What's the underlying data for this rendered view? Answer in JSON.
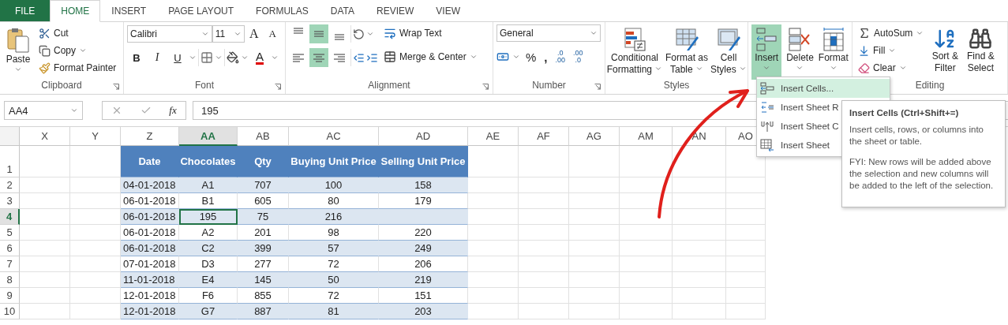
{
  "tabs": [
    {
      "label": "FILE",
      "kind": "file",
      "selected": false
    },
    {
      "label": "HOME",
      "kind": "tab",
      "selected": true
    },
    {
      "label": "INSERT",
      "kind": "tab",
      "selected": false
    },
    {
      "label": "PAGE LAYOUT",
      "kind": "tab",
      "selected": false
    },
    {
      "label": "FORMULAS",
      "kind": "tab",
      "selected": false
    },
    {
      "label": "DATA",
      "kind": "tab",
      "selected": false
    },
    {
      "label": "REVIEW",
      "kind": "tab",
      "selected": false
    },
    {
      "label": "VIEW",
      "kind": "tab",
      "selected": false
    }
  ],
  "clipboard": {
    "label": "Clipboard",
    "paste": "Paste",
    "cut": "Cut",
    "copy": "Copy",
    "format_painter": "Format Painter"
  },
  "font": {
    "label": "Font",
    "name": "Calibri",
    "size": "11",
    "grow": "A",
    "shrink": "A",
    "bold": "B",
    "italic": "I",
    "underline": "U",
    "font_color": "A"
  },
  "alignment": {
    "label": "Alignment",
    "vertical": [
      {
        "selected": false
      },
      {
        "selected": true
      },
      {
        "selected": false
      }
    ],
    "horizontal": [
      {
        "selected": false
      },
      {
        "selected": true
      },
      {
        "selected": false
      }
    ],
    "wrap_text": "Wrap Text",
    "merge_center": "Merge & Center"
  },
  "number": {
    "label": "Number",
    "format": "General",
    "percent": "%",
    "comma": ",",
    "decimals": [
      {
        "top": ".0",
        "bottom": ".00"
      },
      {
        "top": ".00",
        "bottom": ".0"
      }
    ]
  },
  "styles": {
    "label": "Styles",
    "buttons": [
      {
        "kind": "conditional",
        "lines": [
          "Conditional",
          "Formatting"
        ]
      },
      {
        "kind": "table",
        "lines": [
          "Format as",
          "Table"
        ]
      },
      {
        "kind": "cell",
        "lines": [
          "Cell",
          "Styles"
        ]
      }
    ]
  },
  "cells": {
    "buttons": [
      {
        "kind": "insert",
        "label": "Insert",
        "selected": true
      },
      {
        "kind": "delete",
        "label": "Delete",
        "selected": false
      },
      {
        "kind": "format",
        "label": "Format",
        "selected": false
      }
    ]
  },
  "editing": {
    "label": "Editing",
    "autosum": "AutoSum",
    "fill": "Fill",
    "clear": "Clear",
    "sort": [
      "Sort &",
      "Filter"
    ],
    "find": [
      "Find &",
      "Select"
    ]
  },
  "formula_bar": {
    "name_box": "AA4",
    "function_label": "fx",
    "value": "195"
  },
  "sheet": {
    "columns": [
      {
        "label": "X",
        "selected": false
      },
      {
        "label": "Y",
        "selected": false
      },
      {
        "label": "Z",
        "selected": false
      },
      {
        "label": "AA",
        "selected": true
      },
      {
        "label": "AB",
        "selected": false
      },
      {
        "label": "AC",
        "selected": false
      },
      {
        "label": "AD",
        "selected": false
      },
      {
        "label": "AE",
        "selected": false
      },
      {
        "label": "AF",
        "selected": false
      },
      {
        "label": "AG",
        "selected": false
      },
      {
        "label": "AM",
        "selected": false
      },
      {
        "label": "AN",
        "selected": false
      },
      {
        "label": "AO",
        "selected": false
      }
    ],
    "rows": [
      {
        "label": "1",
        "kind": "header",
        "selected": false,
        "cells": [
          "",
          "",
          "Date",
          "Chocolates",
          "Qty",
          "Buying Unit Price",
          "Selling Unit Price"
        ]
      },
      {
        "label": "2",
        "kind": "data",
        "selected": false,
        "cells": [
          "",
          "",
          "04-01-2018",
          "A1",
          "707",
          "100",
          "158"
        ]
      },
      {
        "label": "3",
        "kind": "data",
        "selected": false,
        "cells": [
          "",
          "",
          "06-01-2018",
          "B1",
          "605",
          "80",
          "179"
        ]
      },
      {
        "label": "4",
        "kind": "data",
        "selected": true,
        "cells": [
          "",
          "",
          "06-01-2018",
          "195",
          "75",
          "216",
          ""
        ]
      },
      {
        "label": "5",
        "kind": "data",
        "selected": false,
        "cells": [
          "",
          "",
          "06-01-2018",
          "A2",
          "201",
          "98",
          "220"
        ]
      },
      {
        "label": "6",
        "kind": "data",
        "selected": false,
        "cells": [
          "",
          "",
          "06-01-2018",
          "C2",
          "399",
          "57",
          "249"
        ]
      },
      {
        "label": "7",
        "kind": "data",
        "selected": false,
        "cells": [
          "",
          "",
          "07-01-2018",
          "D3",
          "277",
          "72",
          "206"
        ]
      },
      {
        "label": "8",
        "kind": "data",
        "selected": false,
        "cells": [
          "",
          "",
          "11-01-2018",
          "E4",
          "145",
          "50",
          "219"
        ]
      },
      {
        "label": "9",
        "kind": "data",
        "selected": false,
        "cells": [
          "",
          "",
          "12-01-2018",
          "F6",
          "855",
          "72",
          "151"
        ]
      },
      {
        "label": "10",
        "kind": "data",
        "selected": false,
        "cells": [
          "",
          "",
          "12-01-2018",
          "G7",
          "887",
          "81",
          "203"
        ]
      }
    ]
  },
  "insert_menu": {
    "items": [
      {
        "kind": "cells",
        "label": "Insert Cells...",
        "selected": true
      },
      {
        "kind": "rows",
        "label": "Insert Sheet R",
        "selected": false
      },
      {
        "kind": "columns",
        "label": "Insert Sheet C",
        "selected": false
      },
      {
        "kind": "sheet",
        "label": "Insert Sheet",
        "selected": false
      }
    ]
  },
  "tooltip": {
    "title": "Insert Cells (Ctrl+Shift+=)",
    "body": "Insert cells, rows, or columns into the sheet or table.",
    "note": "FYI: New rows will be added above the selection and new columns will be added to the left of the selection."
  }
}
